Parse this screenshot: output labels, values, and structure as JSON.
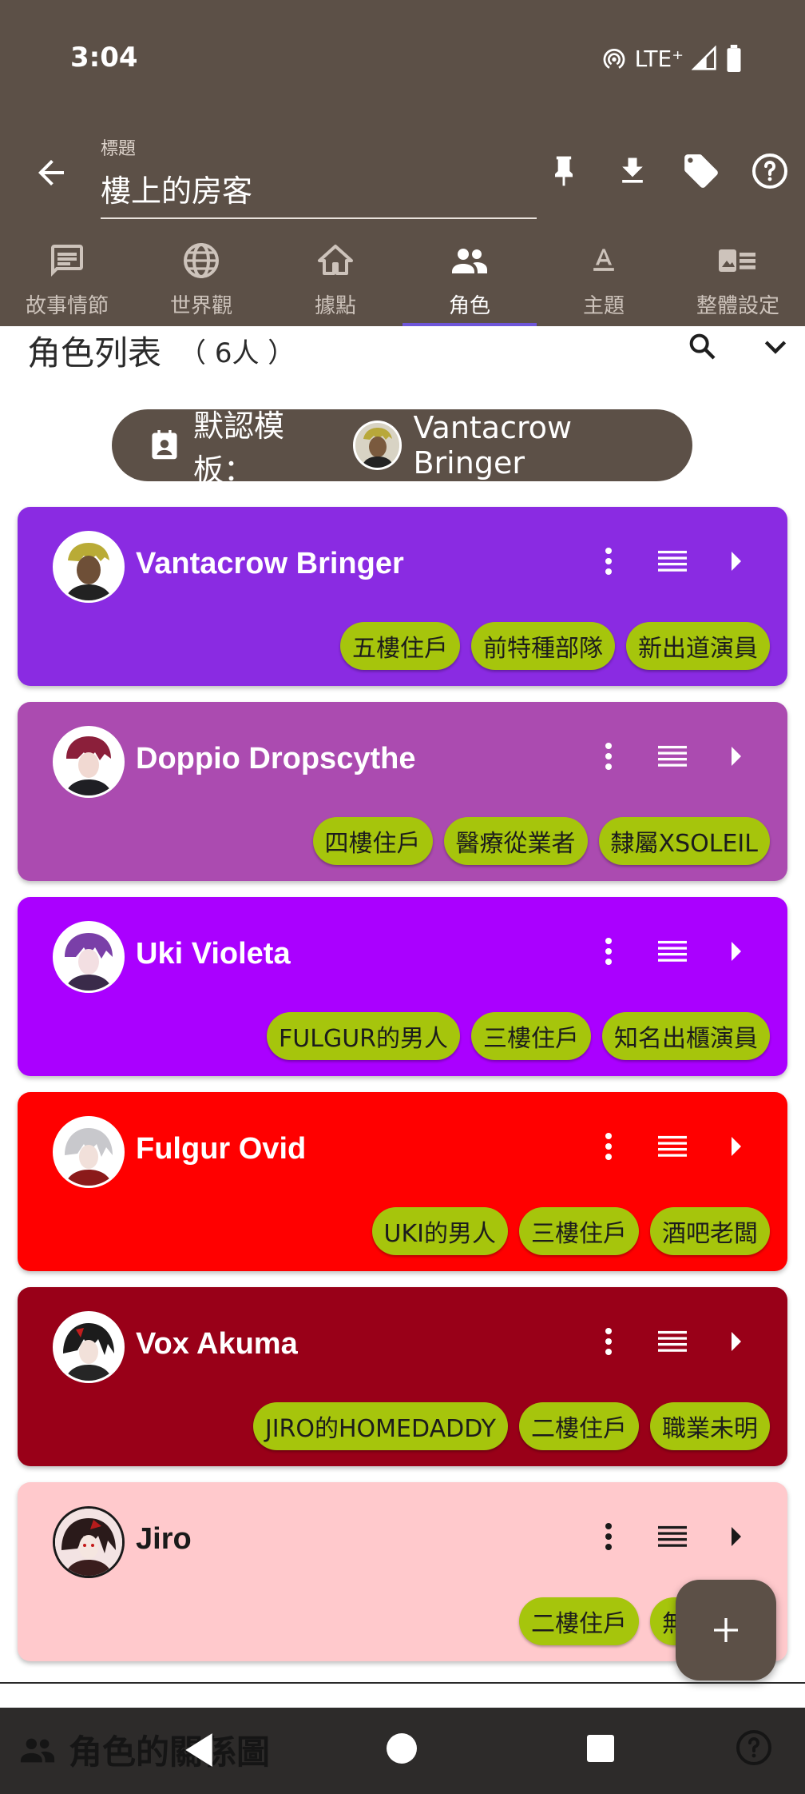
{
  "status": {
    "time": "3:04",
    "network": "LTE⁺"
  },
  "appbar": {
    "title_label": "標題",
    "title_value": "樓上的房客"
  },
  "tabs": [
    {
      "label": "故事情節",
      "icon": "message-icon",
      "active": false
    },
    {
      "label": "世界觀",
      "icon": "globe-icon",
      "active": false
    },
    {
      "label": "據點",
      "icon": "home-icon",
      "active": false
    },
    {
      "label": "角色",
      "icon": "people-icon",
      "active": true
    },
    {
      "label": "主題",
      "icon": "text-format-icon",
      "active": false
    },
    {
      "label": "整體設定",
      "icon": "image-settings-icon",
      "active": false
    }
  ],
  "section": {
    "title": "角色列表",
    "count": "（ 6人 ）"
  },
  "template": {
    "prefix": "默認模板：",
    "name": "Vantacrow Bringer"
  },
  "characters": [
    {
      "name": "Vantacrow Bringer",
      "color": "#8a2be2",
      "tags": [
        "五樓住戶",
        "前特種部隊",
        "新出道演員"
      ]
    },
    {
      "name": "Doppio Dropscythe",
      "color": "#ab4bb0",
      "tags": [
        "四樓住戶",
        "醫療從業者",
        "隸屬XSOLEIL"
      ]
    },
    {
      "name": "Uki Violeta",
      "color": "#aa00ff",
      "tags": [
        "FULGUR的男人",
        "三樓住戶",
        "知名出櫃演員"
      ]
    },
    {
      "name": "Fulgur Ovid",
      "color": "#ff0000",
      "tags": [
        "UKI的男人",
        "三樓住戶",
        "酒吧老闆"
      ]
    },
    {
      "name": "Vox Akuma",
      "color": "#990018",
      "tags": [
        "JIRO的HOMEDADDY",
        "二樓住戶",
        "職業未明"
      ]
    },
    {
      "name": "Jiro",
      "color": "#ffc9cc",
      "tags": [
        "二樓住戶",
        "無業遊民"
      ]
    }
  ],
  "bottom": {
    "relation_label": "角色的關係圖"
  },
  "colors": {
    "chrome": "#5c5047",
    "tag": "#a6c50c",
    "accent": "#6e56d9"
  }
}
